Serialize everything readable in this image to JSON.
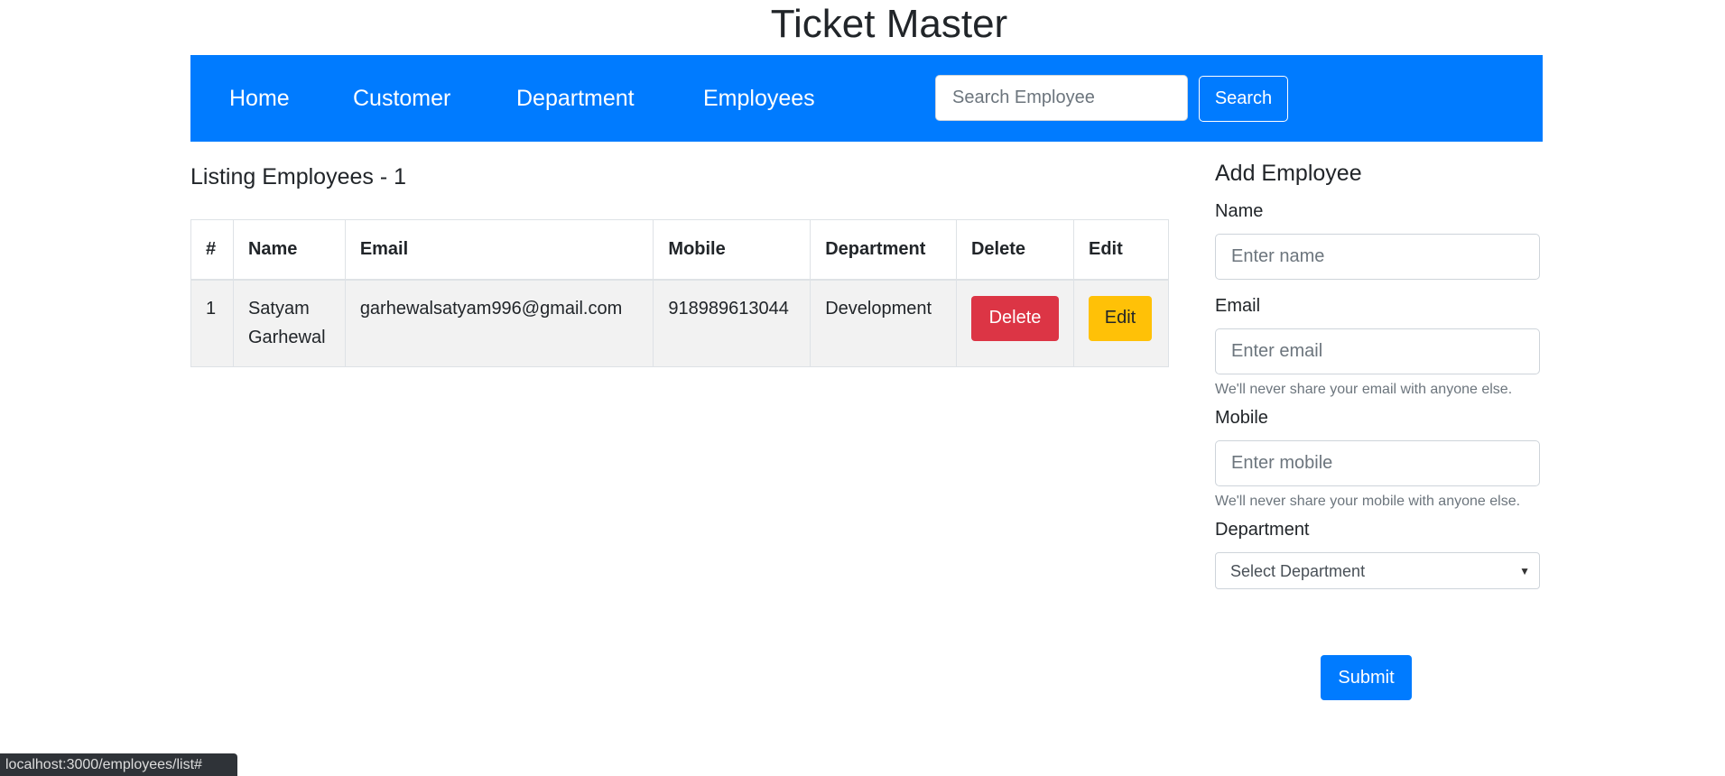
{
  "title": "Ticket Master",
  "nav": {
    "items": [
      "Home",
      "Customer",
      "Department",
      "Employees"
    ],
    "search_placeholder": "Search Employee",
    "search_label": "Search",
    "color": "#007bff"
  },
  "listing": {
    "heading": "Listing Employees - 1",
    "columns": [
      "#",
      "Name",
      "Email",
      "Mobile",
      "Department",
      "Delete",
      "Edit"
    ],
    "rows": [
      {
        "num": "1",
        "name": "Satyam Garhewal",
        "email": "garhewalsatyam996@gmail.com",
        "mobile": "918989613044",
        "department": "Development",
        "delete": "Delete",
        "edit": "Edit"
      }
    ]
  },
  "form": {
    "heading": "Add Employee",
    "name_label": "Name",
    "name_placeholder": "Enter name",
    "email_label": "Email",
    "email_placeholder": "Enter email",
    "email_help": "We'll never share your email with anyone else.",
    "mobile_label": "Mobile",
    "mobile_placeholder": "Enter mobile",
    "mobile_help": "We'll never share your mobile with anyone else.",
    "department_label": "Department",
    "department_selected": "Select Department",
    "submit": "Submit"
  },
  "status_bar": "localhost:3000/employees/list#"
}
